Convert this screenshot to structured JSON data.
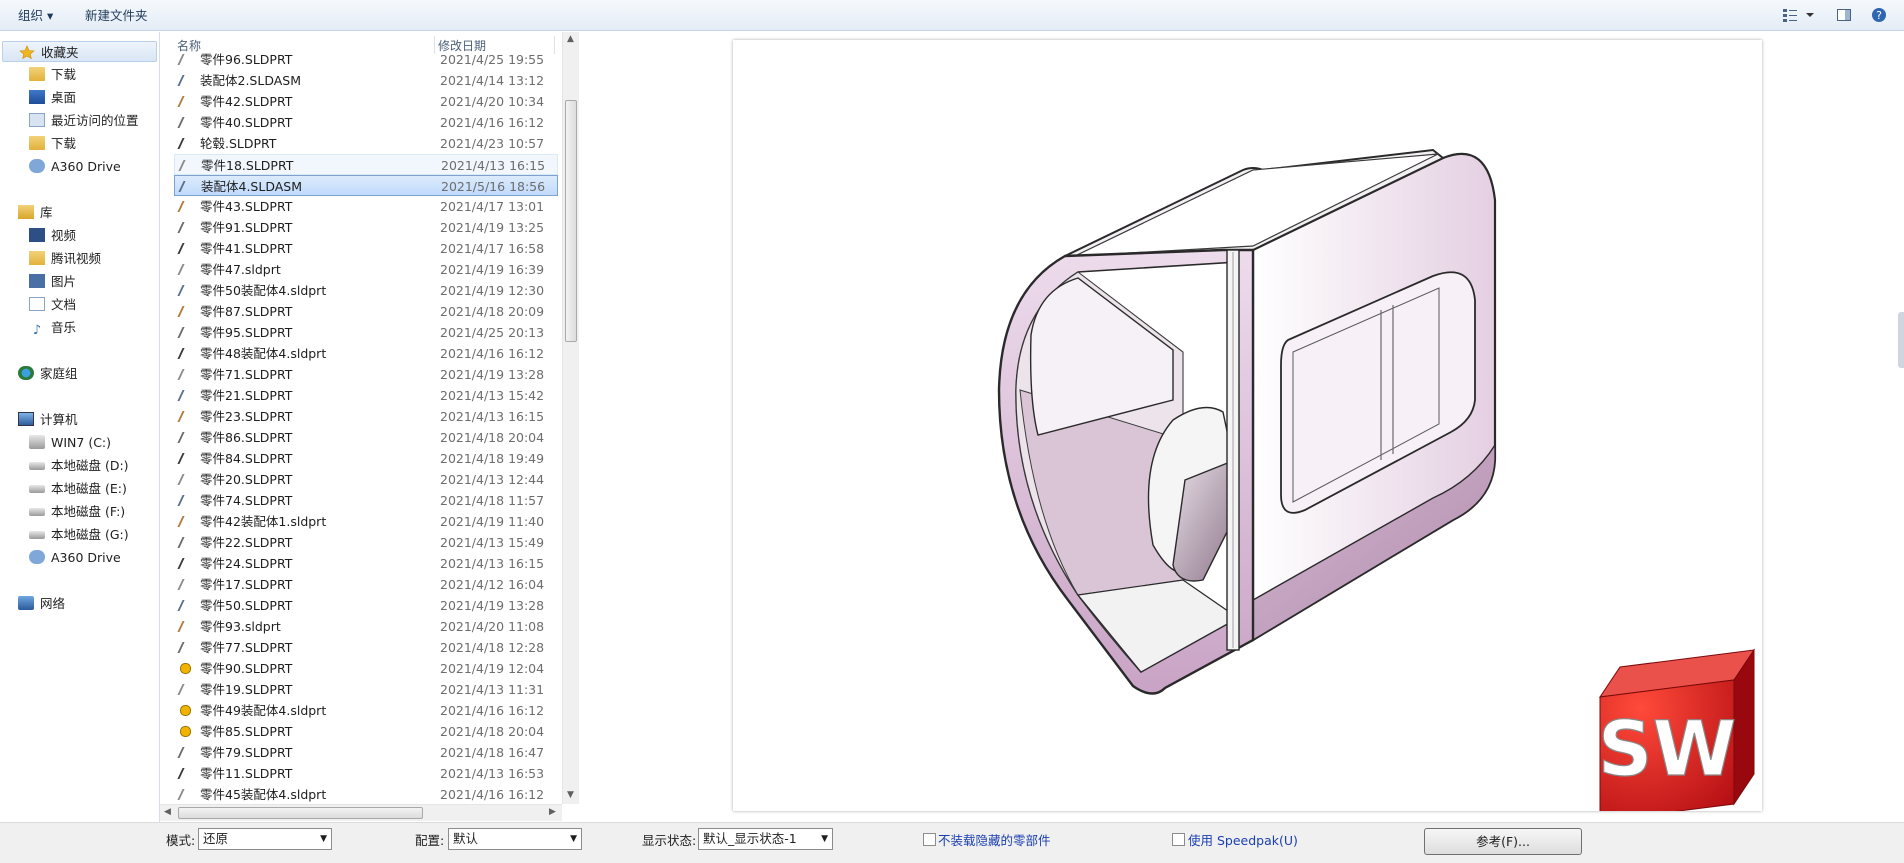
{
  "toolbar": {
    "organize_label": "组织 ▾",
    "new_folder_label": "新建文件夹"
  },
  "nav": {
    "favorites": {
      "label": "收藏夹",
      "items": [
        "下载",
        "桌面",
        "最近访问的位置",
        "下载",
        "A360 Drive"
      ]
    },
    "libraries": {
      "label": "库",
      "items": [
        "视频",
        "腾讯视频",
        "图片",
        "文档",
        "音乐"
      ]
    },
    "homegroup": "家庭组",
    "computer": {
      "label": "计算机",
      "items": [
        "WIN7 (C:)",
        "本地磁盘 (D:)",
        "本地磁盘 (E:)",
        "本地磁盘 (F:)",
        "本地磁盘 (G:)",
        "A360 Drive"
      ]
    },
    "network": "网络"
  },
  "files": {
    "headers": {
      "name": "名称",
      "date": "修改日期"
    },
    "rows": [
      {
        "name": "零件96.SLDPRT",
        "date": "2021/4/25 19:55"
      },
      {
        "name": "装配体2.SLDASM",
        "date": "2021/4/14 13:12"
      },
      {
        "name": "零件42.SLDPRT",
        "date": "2021/4/20 10:34"
      },
      {
        "name": "零件40.SLDPRT",
        "date": "2021/4/16 16:12"
      },
      {
        "name": "轮毂.SLDPRT",
        "date": "2021/4/23 10:57"
      },
      {
        "name": "零件18.SLDPRT",
        "date": "2021/4/13 16:15"
      },
      {
        "name": "装配体4.SLDASM",
        "date": "2021/5/16 18:56"
      },
      {
        "name": "零件43.SLDPRT",
        "date": "2021/4/17 13:01"
      },
      {
        "name": "零件91.SLDPRT",
        "date": "2021/4/19 13:25"
      },
      {
        "name": "零件41.SLDPRT",
        "date": "2021/4/17 16:58"
      },
      {
        "name": "零件47.sldprt",
        "date": "2021/4/19 16:39"
      },
      {
        "name": "零件50装配体4.sldprt",
        "date": "2021/4/19 12:30"
      },
      {
        "name": "零件87.SLDPRT",
        "date": "2021/4/18 20:09"
      },
      {
        "name": "零件95.SLDPRT",
        "date": "2021/4/25 20:13"
      },
      {
        "name": "零件48装配体4.sldprt",
        "date": "2021/4/16 16:12"
      },
      {
        "name": "零件71.SLDPRT",
        "date": "2021/4/19 13:28"
      },
      {
        "name": "零件21.SLDPRT",
        "date": "2021/4/13 15:42"
      },
      {
        "name": "零件23.SLDPRT",
        "date": "2021/4/13 16:15"
      },
      {
        "name": "零件86.SLDPRT",
        "date": "2021/4/18 20:04"
      },
      {
        "name": "零件84.SLDPRT",
        "date": "2021/4/18 19:49"
      },
      {
        "name": "零件20.SLDPRT",
        "date": "2021/4/13 12:44"
      },
      {
        "name": "零件74.SLDPRT",
        "date": "2021/4/18 11:57"
      },
      {
        "name": "零件42装配体1.sldprt",
        "date": "2021/4/19 11:40"
      },
      {
        "name": "零件22.SLDPRT",
        "date": "2021/4/13 15:49"
      },
      {
        "name": "零件24.SLDPRT",
        "date": "2021/4/13 16:15"
      },
      {
        "name": "零件17.SLDPRT",
        "date": "2021/4/12 16:04"
      },
      {
        "name": "零件50.SLDPRT",
        "date": "2021/4/19 13:28"
      },
      {
        "name": "零件93.sldprt",
        "date": "2021/4/20 11:08"
      },
      {
        "name": "零件77.SLDPRT",
        "date": "2021/4/18 12:28"
      },
      {
        "name": "零件90.SLDPRT",
        "date": "2021/4/19 12:04"
      },
      {
        "name": "零件19.SLDPRT",
        "date": "2021/4/13 11:31"
      },
      {
        "name": "零件49装配体4.sldprt",
        "date": "2021/4/16 16:12"
      },
      {
        "name": "零件85.SLDPRT",
        "date": "2021/4/18 20:04"
      },
      {
        "name": "零件79.SLDPRT",
        "date": "2021/4/18 16:47"
      },
      {
        "name": "零件11.SLDPRT",
        "date": "2021/4/13 16:53"
      },
      {
        "name": "零件45装配体4.sldprt",
        "date": "2021/4/16 16:12"
      }
    ]
  },
  "bottom": {
    "mode_label": "模式:",
    "mode_value": "还原",
    "config_label": "配置:",
    "config_value": "默认",
    "display_label": "显示状态:",
    "display_value": "默认_显示状态-1",
    "hidden_parts_label": "不装载隐藏的零部件",
    "speedpak_label": "使用 Speedpak(U)",
    "reference_button": "参考(F)..."
  },
  "logo": {
    "text": "SW"
  },
  "colors": {
    "logo_red": "#d4161b",
    "selection": "#c9defa",
    "accent_link": "#1a3fb0"
  }
}
